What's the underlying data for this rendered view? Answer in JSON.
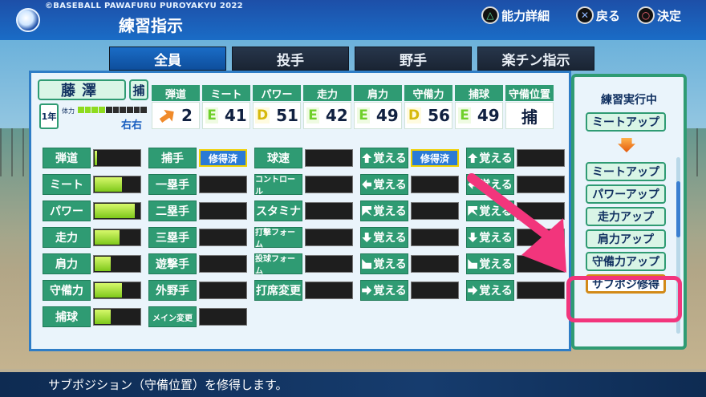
{
  "header": {
    "brand": "©BASEBALL PAWAFURU PUROYAKYU 2022",
    "title": "練習指示",
    "hints": [
      {
        "symbol": "△",
        "label": "能力詳細"
      },
      {
        "symbol": "✕",
        "label": "戻る"
      },
      {
        "symbol": "○",
        "label": "決定"
      }
    ]
  },
  "tabs": [
    "全員",
    "投手",
    "野手",
    "楽チン指示"
  ],
  "player": {
    "name": "藤澤",
    "position_mark": "捕",
    "grade": "1年",
    "stamina_label": "体力",
    "stamina_segments": 10,
    "stamina_filled": 4,
    "handedness": "右右"
  },
  "stats": [
    {
      "label": "弾道",
      "rank": "",
      "value": "2",
      "icon": "trajectory-arrow-icon"
    },
    {
      "label": "ミート",
      "rank": "E",
      "value": "41"
    },
    {
      "label": "パワー",
      "rank": "D",
      "value": "51"
    },
    {
      "label": "走力",
      "rank": "E",
      "value": "42"
    },
    {
      "label": "肩力",
      "rank": "E",
      "value": "49"
    },
    {
      "label": "守備力",
      "rank": "D",
      "value": "56"
    },
    {
      "label": "捕球",
      "rank": "E",
      "value": "49"
    },
    {
      "label": "守備位置",
      "rank": "",
      "value": "捕"
    }
  ],
  "grid": {
    "col1": [
      {
        "label": "弾道",
        "fill": 0.05
      },
      {
        "label": "ミート",
        "fill": 0.6
      },
      {
        "label": "パワー",
        "fill": 0.9
      },
      {
        "label": "走力",
        "fill": 0.55
      },
      {
        "label": "肩力",
        "fill": 0.35
      },
      {
        "label": "守備力",
        "fill": 0.6
      },
      {
        "label": "捕球",
        "fill": 0.35
      }
    ],
    "col2": [
      {
        "label": "捕手",
        "tag": "修得済"
      },
      {
        "label": "一塁手"
      },
      {
        "label": "二塁手"
      },
      {
        "label": "三塁手"
      },
      {
        "label": "遊撃手"
      },
      {
        "label": "外野手"
      },
      {
        "label": "メイン変更"
      }
    ],
    "col3": [
      {
        "label": "球速"
      },
      {
        "label": "コントロール"
      },
      {
        "label": "スタミナ"
      },
      {
        "label": "打撃フォーム"
      },
      {
        "label": "投球フォーム"
      },
      {
        "label": "打席変更"
      }
    ],
    "col4": [
      {
        "label": "覚える",
        "tag": "修得済"
      },
      {
        "label": "覚える"
      },
      {
        "label": "覚える"
      },
      {
        "label": "覚える"
      },
      {
        "label": "覚える"
      },
      {
        "label": "覚える"
      }
    ],
    "col5": [
      {
        "label": "覚える"
      },
      {
        "label": "覚える"
      },
      {
        "label": "覚える"
      },
      {
        "label": "覚える"
      },
      {
        "label": "覚える"
      },
      {
        "label": "覚える"
      }
    ]
  },
  "practice": {
    "header": "練習実行中",
    "current": "ミートアップ",
    "options": [
      "ミートアップ",
      "パワーアップ",
      "走力アップ",
      "肩力アップ",
      "守備力アップ",
      "サブポジ修得"
    ]
  },
  "description": "サブポジション（守備位置）を修得します。",
  "colors": {
    "accent_green": "#2f9b73",
    "highlight_pink": "#f2357c",
    "header_blue": "#1a6cc6"
  }
}
